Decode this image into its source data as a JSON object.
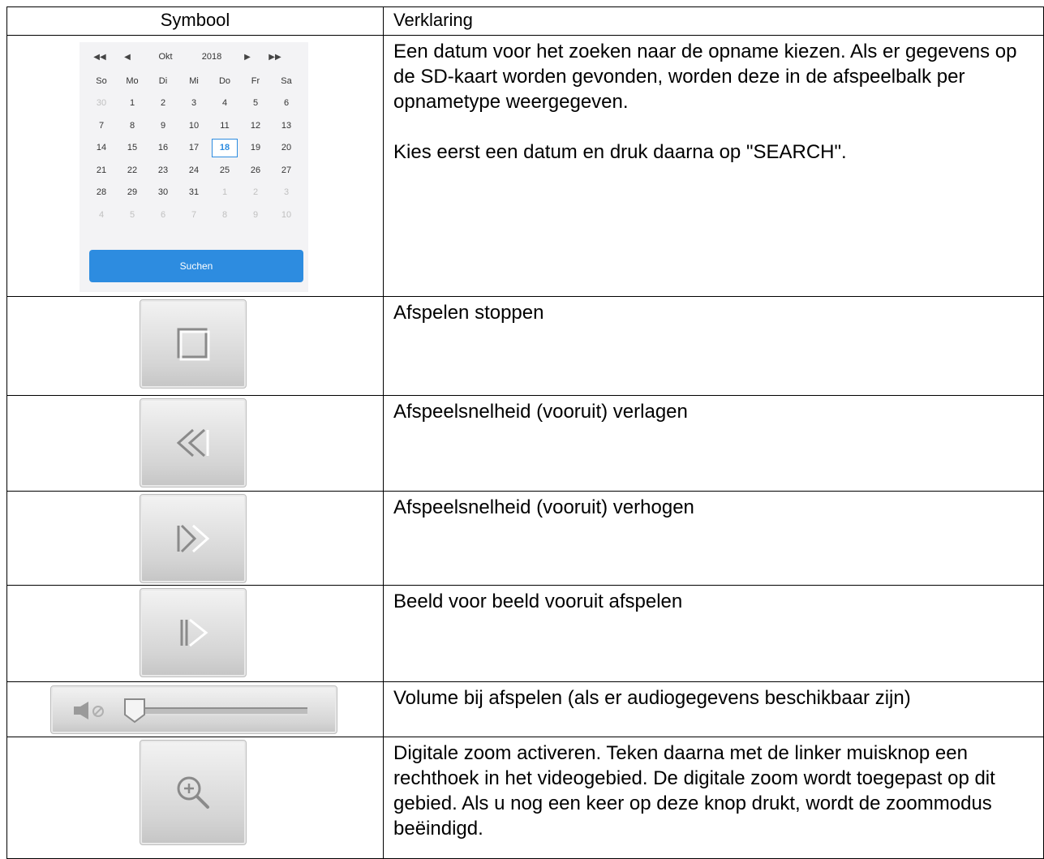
{
  "header": {
    "symbol": "Symbool",
    "explanation": "Verklaring"
  },
  "calendar": {
    "prev_year_icon": "double-chevron-left-icon",
    "prev_month_icon": "chevron-left-icon",
    "next_month_icon": "chevron-right-icon",
    "next_year_icon": "double-chevron-right-icon",
    "month": "Okt",
    "year": "2018",
    "weekdays": [
      "So",
      "Mo",
      "Di",
      "Mi",
      "Do",
      "Fr",
      "Sa"
    ],
    "days": [
      {
        "d": "30",
        "m": true
      },
      {
        "d": "1"
      },
      {
        "d": "2"
      },
      {
        "d": "3"
      },
      {
        "d": "4"
      },
      {
        "d": "5"
      },
      {
        "d": "6"
      },
      {
        "d": "7"
      },
      {
        "d": "8"
      },
      {
        "d": "9"
      },
      {
        "d": "10"
      },
      {
        "d": "11"
      },
      {
        "d": "12"
      },
      {
        "d": "13"
      },
      {
        "d": "14"
      },
      {
        "d": "15"
      },
      {
        "d": "16"
      },
      {
        "d": "17"
      },
      {
        "d": "18",
        "s": true
      },
      {
        "d": "19"
      },
      {
        "d": "20"
      },
      {
        "d": "21"
      },
      {
        "d": "22"
      },
      {
        "d": "23"
      },
      {
        "d": "24"
      },
      {
        "d": "25"
      },
      {
        "d": "26"
      },
      {
        "d": "27"
      },
      {
        "d": "28"
      },
      {
        "d": "29"
      },
      {
        "d": "30"
      },
      {
        "d": "31"
      },
      {
        "d": "1",
        "m": true
      },
      {
        "d": "2",
        "m": true
      },
      {
        "d": "3",
        "m": true
      },
      {
        "d": "4",
        "m": true
      },
      {
        "d": "5",
        "m": true
      },
      {
        "d": "6",
        "m": true
      },
      {
        "d": "7",
        "m": true
      },
      {
        "d": "8",
        "m": true
      },
      {
        "d": "9",
        "m": true
      },
      {
        "d": "10",
        "m": true
      }
    ],
    "selected_day": "18",
    "search_button": "Suchen",
    "accent_color": "#2d8ce0"
  },
  "rows": [
    {
      "icon": "calendar-widget",
      "paragraphs": [
        "Een datum voor het zoeken naar de opname kiezen. Als er gegevens op de SD-kaart worden gevonden, worden deze in de afspeelbalk per opnametype weergegeven.",
        "Kies eerst een datum en druk daarna op \"SEARCH\"."
      ]
    },
    {
      "icon": "stop-icon",
      "paragraphs": [
        "Afspelen stoppen"
      ]
    },
    {
      "icon": "rewind-icon",
      "paragraphs": [
        "Afspeelsnelheid (vooruit) verlagen"
      ]
    },
    {
      "icon": "fast-forward-icon",
      "paragraphs": [
        "Afspeelsnelheid (vooruit) verhogen"
      ]
    },
    {
      "icon": "step-forward-icon",
      "paragraphs": [
        "Beeld voor beeld vooruit afspelen"
      ]
    },
    {
      "icon": "volume-slider",
      "paragraphs": [
        "Volume bij afspelen (als er audiogegevens beschikbaar zijn)"
      ]
    },
    {
      "icon": "zoom-in-icon",
      "paragraphs": [
        "Digitale zoom activeren. Teken daarna met de linker muisknop een rechthoek in het videogebied. De digitale zoom wordt toegepast op dit gebied. Als u nog een keer op deze knop drukt, wordt de zoommodus beëindigd."
      ]
    }
  ],
  "volume": {
    "level": 0,
    "speaker_icon": "speaker-muted-icon"
  }
}
